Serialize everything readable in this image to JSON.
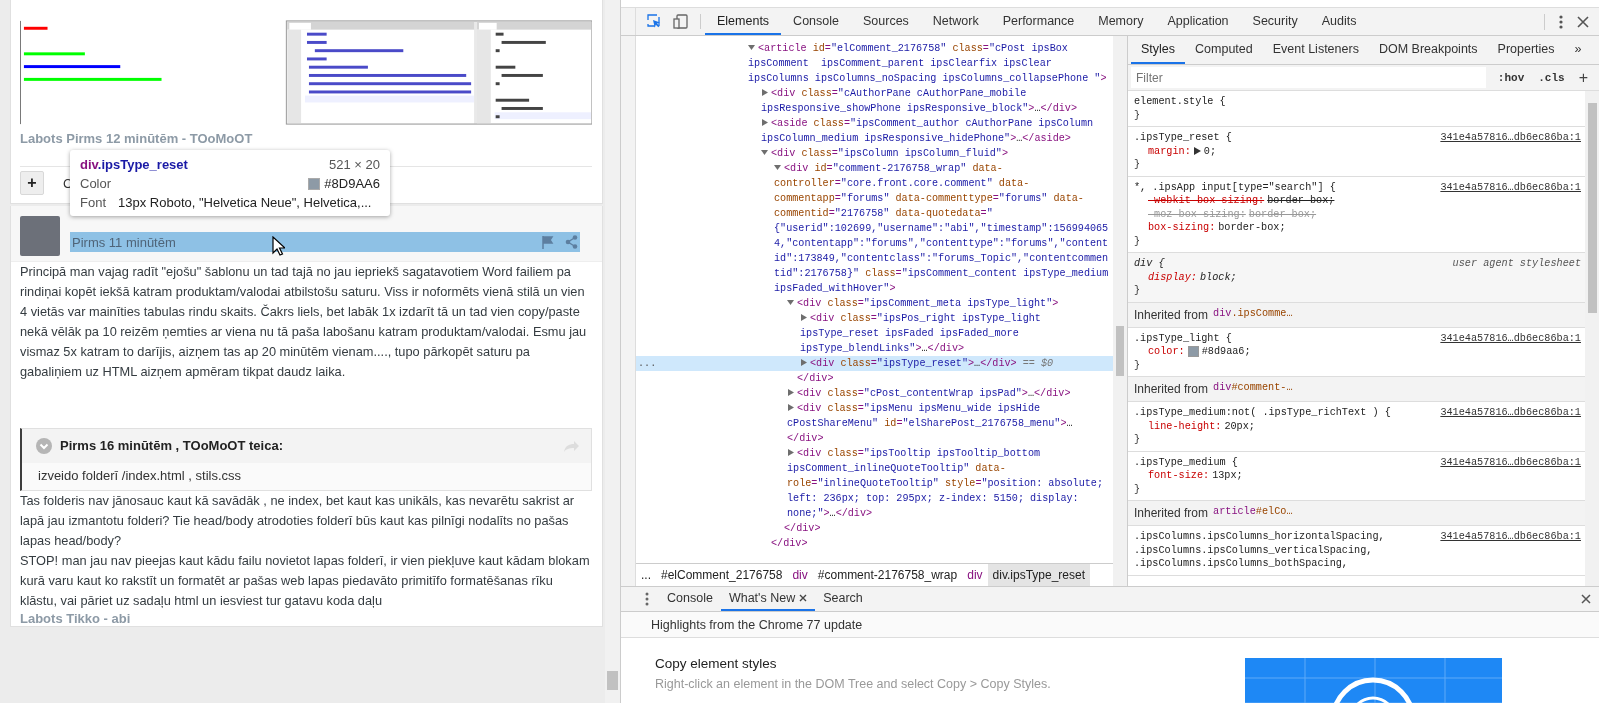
{
  "page": {
    "edited_note": "Labots Pirms 12 minūtēm - TOoMoOT",
    "add_button": "+",
    "quote_link": "C",
    "post": {
      "time": "Pirms 11 minūtēm",
      "highlighted": true,
      "paragraphs": [
        "Principā man vajag radīt \"ejošu\" šablonu un tad tajā no jau iepriekš sagatavotiem Word failiem pa rindiņai kopēt iekšā katram produktam/valodai atbilstošu saturu. Viss ir noformēts vienā stilā un vien 4 vietās var mainīties tabulas rindu skaits. Čakrs liels, bet labāk 1x izdarīt tā un tad vien copy/paste nekā vēlāk pa 10 reizēm ņemties ar viena nu tā paša labošanu katram produktam/valodai. Esmu jau vismaz 5x katram to darījis, aizņem tas ap 20 minūtēm vienam...., tupo pārkopēt saturu pa gabaliņiem uz HTML aizņem apmēram tikpat daudz laika."
      ],
      "quote": {
        "header": "Pirms 16 minūtēm , TOoMoOT teica:",
        "body": "izveido folderī /index.html , stils.css"
      },
      "paragraphs_after": [
        "Tas folderis nav jānosauc kaut kā savādāk , ne index, bet kaut kas unikāls, kas nevarētu sakrist ar lapā jau izmantotu folderi? Tie head/body atrodoties folderī būs kaut kas pilnīgi nodalīts no pašas lapas head/body?",
        "STOP! man jau nav pieejas kaut kādu failu novietot lapas folderī, ir vien piekļuve kaut kādam blokam kurā varu kaut ko rakstīt un formatēt ar pašas web lapas piedavāto primitīfo formatēšanas rīku klāstu, vai pāriet uz sadaļu html un iesviest tur gatavu koda daļu"
      ],
      "edited_note": "Labots Tikko - abi"
    }
  },
  "inspect_tooltip": {
    "tag": "div",
    "selector": ".ipsType_reset",
    "size": "521 × 20",
    "color_label": "Color",
    "color_value": "#8D9AA6",
    "color": "#8d9aa6",
    "font_label": "Font",
    "font_value": "13px Roboto, \"Helvetica Neue\", Helvetica,..."
  },
  "devtools": {
    "tools": [
      {
        "kind": "inspect",
        "on": true
      },
      {
        "kind": "device",
        "on": false
      }
    ],
    "tabs": [
      {
        "label": "Elements",
        "selected": true
      },
      {
        "label": "Console",
        "selected": false
      },
      {
        "label": "Sources",
        "selected": false
      },
      {
        "label": "Network",
        "selected": false
      },
      {
        "label": "Performance",
        "selected": false
      },
      {
        "label": "Memory",
        "selected": false
      },
      {
        "label": "Application",
        "selected": false
      },
      {
        "label": "Security",
        "selected": false
      },
      {
        "label": "Audits",
        "selected": false
      }
    ],
    "dom_tree": [
      {
        "text": "<article id=\"elComment_2176758\" class=\"cPost ipsBox ipsComment  ipsComment_parent ipsClearfix ipsClear ipsColumns ipsColumns_noSpacing ipsColumns_collapsePhone \">",
        "expanded": true,
        "selected": false,
        "children": [
          {
            "text": "<div class=\"cAuthorPane cAuthorPane_mobile ipsResponsive_showPhone ipsResponsive_block\">…</div>",
            "expanded": false,
            "selected": false
          },
          {
            "text": "<aside class=\"ipsComment_author cAuthorPane ipsColumn ipsColumn_medium ipsResponsive_hidePhone\">…</aside>",
            "expanded": false,
            "selected": false
          },
          {
            "text": "<div class=\"ipsColumn ipsColumn_fluid\">",
            "expanded": true,
            "selected": false,
            "close": "</div>",
            "children": [
              {
                "text": "<div id=\"comment-2176758_wrap\" data-controller=\"core.front.core.comment\" data-commentapp=\"forums\" data-commenttype=\"forums\" data-commentid=\"2176758\" data-quotedata=\"{\"userid\":102699,\"username\":\"abi\",\"timestamp\":1569940654,\"contentapp\":\"forums\",\"contenttype\":\"forums\",\"contentid\":173849,\"contentclass\":\"forums_Topic\",\"contentcommentid\":2176758}\" class=\"ipsComment_content ipsType_medium ipsFaded_withHover\">",
                "expanded": true,
                "selected": false,
                "close": "</div>",
                "children": [
                  {
                    "text": "<div class=\"ipsComment_meta ipsType_light\">",
                    "expanded": true,
                    "selected": false,
                    "close": "</div>",
                    "children": [
                      {
                        "text": "<div class=\"ipsPos_right ipsType_light ipsType_reset ipsFaded ipsFaded_more ipsType_blendLinks\">…</div>",
                        "expanded": false,
                        "selected": false
                      },
                      {
                        "text": "<div class=\"ipsType_reset\">…</div>",
                        "expanded": false,
                        "selected": true,
                        "gutter": "...",
                        "suffix": "== $0"
                      }
                    ]
                  },
                  {
                    "text": "<div class=\"cPost_contentWrap ipsPad\">…</div>",
                    "expanded": false,
                    "selected": false
                  },
                  {
                    "text": "<div class=\"ipsMenu ipsMenu_wide ipsHide cPostShareMenu\" id=\"elSharePost_2176758_menu\">…</div>",
                    "expanded": false,
                    "selected": false
                  },
                  {
                    "text": "<div class=\"ipsTooltip ipsTooltip_bottom ipsComment_inlineQuoteTooltip\" data-role=\"inlineQuoteTooltip\" style=\"position: absolute; left: 236px; top: 295px; z-index: 5150; display: none;\">…</div>",
                    "expanded": false,
                    "selected": false
                  }
                ]
              }
            ]
          }
        ]
      }
    ],
    "breadcrumbs": [
      {
        "label": "...",
        "kind": "more",
        "selected": false
      },
      {
        "label": "#elComment_2176758",
        "kind": "id",
        "selected": false
      },
      {
        "label": "div",
        "kind": "tag",
        "selected": false
      },
      {
        "label": "#comment-2176758_wrap",
        "kind": "id",
        "selected": false
      },
      {
        "label": "div",
        "kind": "tag",
        "selected": false
      },
      {
        "label": "div.ipsType_reset",
        "kind": "node",
        "selected": true
      }
    ],
    "styles": {
      "tabs": [
        {
          "label": "Styles",
          "selected": true
        },
        {
          "label": "Computed",
          "selected": false
        },
        {
          "label": "Event Listeners",
          "selected": false
        },
        {
          "label": "DOM Breakpoints",
          "selected": false
        },
        {
          "label": "Properties",
          "selected": false
        }
      ],
      "overflow": "»",
      "filter": {
        "placeholder": "Filter"
      },
      "toggles": [
        ":hov",
        ".cls"
      ],
      "add": "+",
      "rules": [
        {
          "kind": "rule",
          "user_agent": false,
          "selector": "element.style {",
          "close": "}"
        },
        {
          "kind": "rule",
          "user_agent": false,
          "selector": ".ipsType_reset {",
          "source": "341e4a57816…db6ec86ba:1",
          "declarations": [
            {
              "name": "margin:",
              "value": "0;",
              "overridden": false,
              "invalid": false,
              "expandable": true
            }
          ],
          "close": "}"
        },
        {
          "kind": "rule",
          "user_agent": false,
          "selector": "*, .ipsApp input[type=\"search\"] {",
          "source": "341e4a57816…db6ec86ba:1",
          "declarations": [
            {
              "name": "-webkit-box-sizing:",
              "value": "border-box;",
              "overridden": true,
              "invalid": false
            },
            {
              "name": "-moz-box-sizing:",
              "value": "border-box;",
              "overridden": true,
              "invalid": true
            },
            {
              "name": "box-sizing:",
              "value": "border-box;",
              "overridden": false,
              "invalid": false
            }
          ],
          "close": "}"
        },
        {
          "kind": "rule",
          "user_agent": true,
          "selector": "div {",
          "source": "user agent stylesheet",
          "declarations": [
            {
              "name": "display:",
              "value": "block;",
              "overridden": false,
              "invalid": false
            }
          ],
          "close": "}"
        },
        {
          "kind": "inherited",
          "label": "Inherited from",
          "tag": "div",
          "selector": ".ipsComme…"
        },
        {
          "kind": "rule",
          "user_agent": false,
          "selector": ".ipsType_light {",
          "source": "341e4a57816…db6ec86ba:1",
          "declarations": [
            {
              "name": "color:",
              "value": "#8d9aa6;",
              "overridden": false,
              "invalid": false,
              "color": "#8d9aa6"
            }
          ],
          "close": "}"
        },
        {
          "kind": "inherited",
          "label": "Inherited from",
          "tag": "div",
          "selector": "#comment-…"
        },
        {
          "kind": "rule",
          "user_agent": false,
          "selector": ".ipsType_medium:not( .ipsType_richText ) {",
          "source": "341e4a57816…db6ec86ba:1",
          "declarations": [
            {
              "name": "line-height:",
              "value": "20px;",
              "overridden": false,
              "invalid": false
            }
          ],
          "close": "}"
        },
        {
          "kind": "rule",
          "user_agent": false,
          "selector": ".ipsType_medium {",
          "source": "341e4a57816…db6ec86ba:1",
          "declarations": [
            {
              "name": "font-size:",
              "value": "13px;",
              "overridden": false,
              "invalid": false
            }
          ],
          "close": "}"
        },
        {
          "kind": "inherited",
          "label": "Inherited from",
          "tag": "article",
          "selector": "#elCo…"
        },
        {
          "kind": "rule",
          "user_agent": false,
          "selector": ".ipsColumns.ipsColumns_horizontalSpacing, .ipsColumns.ipsColumns_verticalSpacing, .ipsColumns.ipsColumns_bothSpacing,",
          "source": "341e4a57816…db6ec86ba:1"
        }
      ]
    },
    "drawer": {
      "tabs": [
        {
          "label": "Console",
          "selected": false,
          "closable": false
        },
        {
          "label": "What's New",
          "selected": true,
          "closable": true
        },
        {
          "label": "Search",
          "selected": false,
          "closable": false
        }
      ],
      "banner": "Highlights from the Chrome 77 update",
      "feature": {
        "title": "Copy element styles",
        "description": "Right-click an element in the DOM Tree and select Copy > Copy Styles."
      }
    }
  }
}
